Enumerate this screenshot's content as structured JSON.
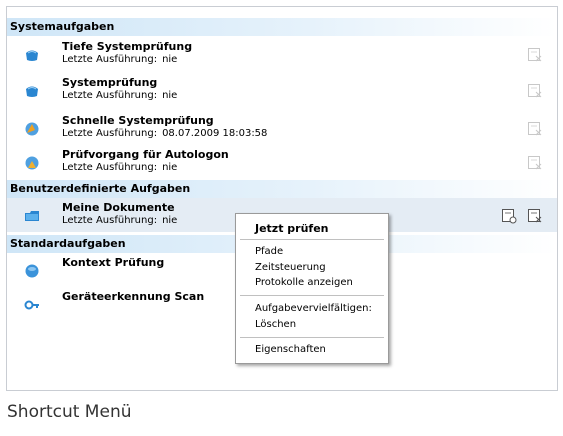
{
  "sections": [
    {
      "title": "Systemaufgaben"
    },
    {
      "title": "Benutzerdefinierte Aufgaben"
    },
    {
      "title": "Standardaufgaben"
    }
  ],
  "tasks": [
    {
      "name": "Tiefe Systemprüfung",
      "last_label": "Letzte Ausführung:",
      "last_value": "nie",
      "icon": "deep-scan-icon"
    },
    {
      "name": "Systemprüfung",
      "last_label": "Letzte Ausführung:",
      "last_value": "nie",
      "icon": "system-scan-icon"
    },
    {
      "name": "Schnelle Systemprüfung",
      "last_label": "Letzte Ausführung:",
      "last_value": "08.07.2009 18:03:58",
      "icon": "quick-scan-icon"
    },
    {
      "name": "Prüfvorgang für Autologon",
      "last_label": "Letzte Ausführung:",
      "last_value": "nie",
      "icon": "autologon-scan-icon"
    },
    {
      "name": "Meine Dokumente",
      "last_label": "Letzte Ausführung:",
      "last_value": "nie",
      "icon": "folder-scan-icon"
    },
    {
      "name": "Kontext Prüfung",
      "icon": "context-scan-icon"
    },
    {
      "name": "Geräteerkennung Scan",
      "icon": "device-scan-icon"
    }
  ],
  "context_menu": {
    "items": [
      "Jetzt prüfen",
      "Pfade",
      "Zeitsteuerung",
      "Protokolle anzeigen",
      "Aufgabevervielfältigen:",
      "Löschen",
      "Eigenschaften"
    ]
  },
  "caption": "Shortcut Menü"
}
